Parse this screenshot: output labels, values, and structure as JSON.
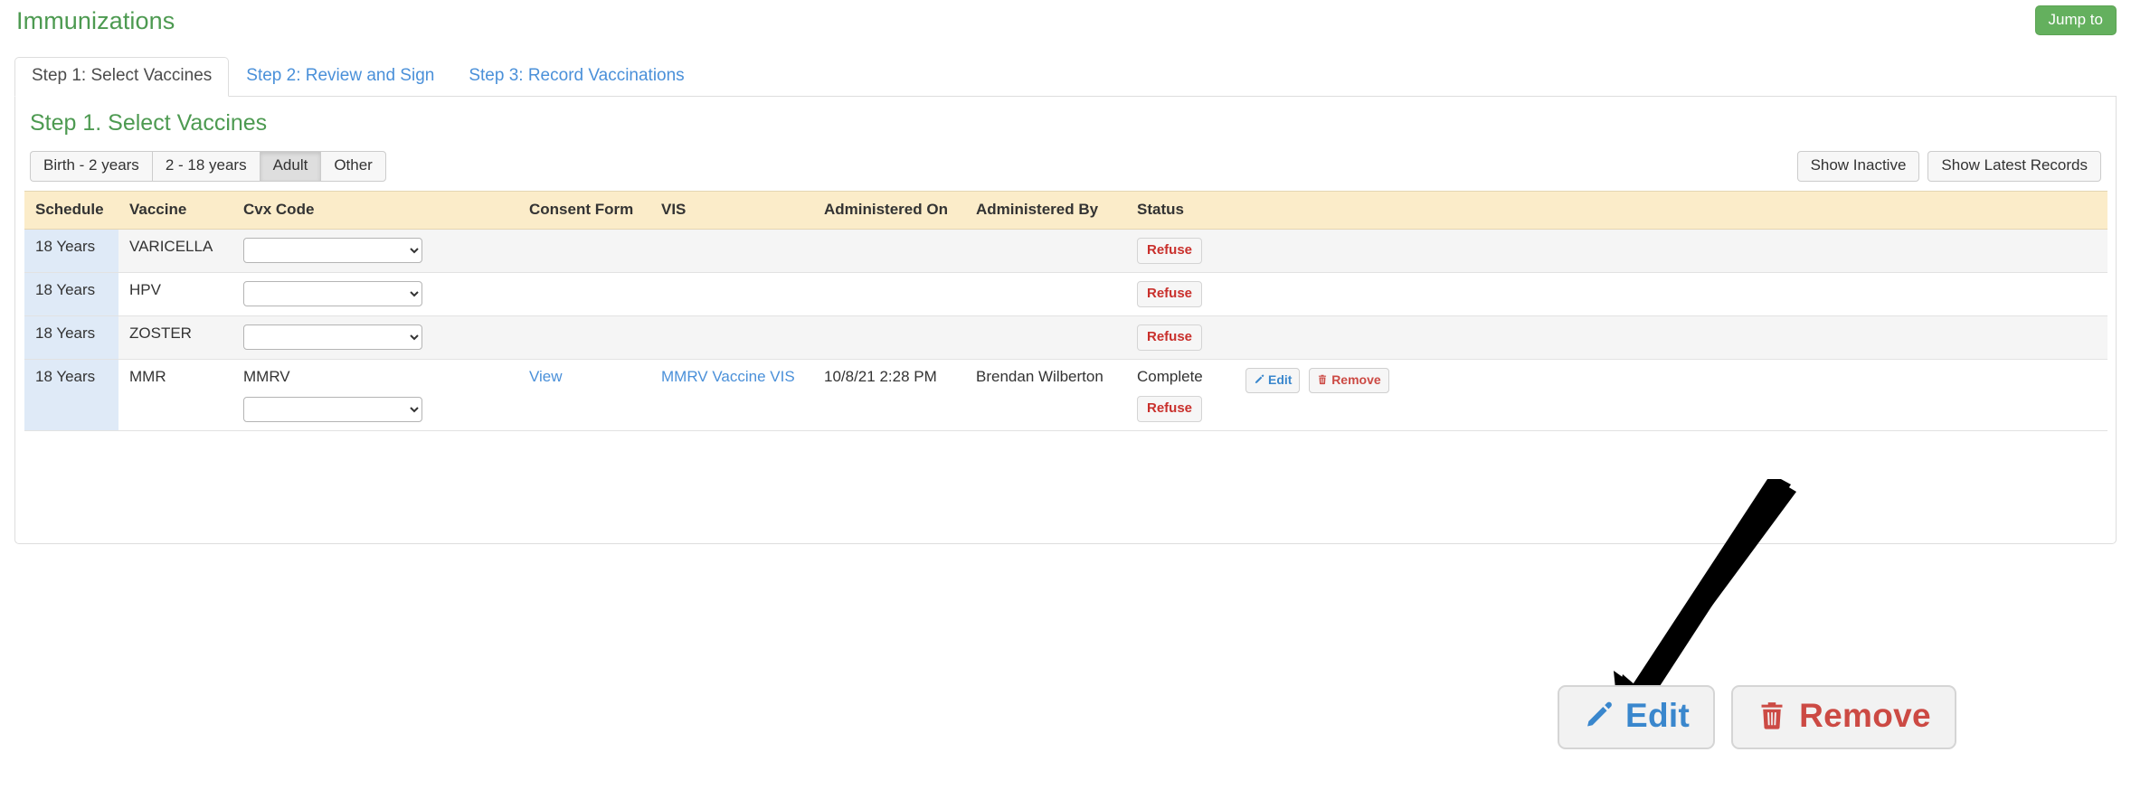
{
  "header": {
    "title": "Immunizations",
    "jump_to_label": "Jump to",
    "title_color": "#4d9a51",
    "jump_to_color": "#64b05e"
  },
  "tabs": [
    {
      "label": "Step 1: Select Vaccines",
      "active": true
    },
    {
      "label": "Step 2: Review and Sign",
      "active": false
    },
    {
      "label": "Step 3: Record Vaccinations",
      "active": false
    }
  ],
  "main": {
    "step_heading": "Step 1. Select Vaccines",
    "age_filters": [
      {
        "label": "Birth - 2 years",
        "active": false
      },
      {
        "label": "2 - 18 years",
        "active": false
      },
      {
        "label": "Adult",
        "active": true
      },
      {
        "label": "Other",
        "active": false
      }
    ],
    "right_buttons": [
      {
        "label": "Show Inactive"
      },
      {
        "label": "Show Latest Records"
      }
    ]
  },
  "table": {
    "columns": [
      "Schedule",
      "Vaccine",
      "Cvx Code",
      "Consent Form",
      "VIS",
      "Administered On",
      "Administered By",
      "Status",
      ""
    ],
    "rows": [
      {
        "schedule": "18 Years",
        "vaccine": "VARICELLA",
        "cvx_code": "",
        "cvx_select_value": "",
        "consent_form": "",
        "vis": "",
        "administered_on": "",
        "administered_by": "",
        "status": "",
        "refuse_label": "Refuse",
        "has_actions": false
      },
      {
        "schedule": "18 Years",
        "vaccine": "HPV",
        "cvx_code": "",
        "cvx_select_value": "",
        "consent_form": "",
        "vis": "",
        "administered_on": "",
        "administered_by": "",
        "status": "",
        "refuse_label": "Refuse",
        "has_actions": false
      },
      {
        "schedule": "18 Years",
        "vaccine": "ZOSTER",
        "cvx_code": "",
        "cvx_select_value": "",
        "consent_form": "",
        "vis": "",
        "administered_on": "",
        "administered_by": "",
        "status": "",
        "refuse_label": "Refuse",
        "has_actions": false
      },
      {
        "schedule": "18 Years",
        "vaccine": "MMR",
        "cvx_code": "MMRV",
        "cvx_select_value": "",
        "consent_form": "View",
        "vis": "MMRV Vaccine VIS",
        "administered_on": "10/8/21 2:28 PM",
        "administered_by": "Brendan Wilberton",
        "status": "Complete",
        "refuse_label": "Refuse",
        "has_actions": true,
        "edit_label": "Edit",
        "remove_label": "Remove"
      }
    ],
    "header_bg": "#fbecc8",
    "schedule_col_bg": "#dfeaf7",
    "link_color": "#4a90d9"
  },
  "callout": {
    "edit_label": "Edit",
    "remove_label": "Remove",
    "edit_color": "#3a87cd",
    "remove_color": "#cc4a44"
  }
}
